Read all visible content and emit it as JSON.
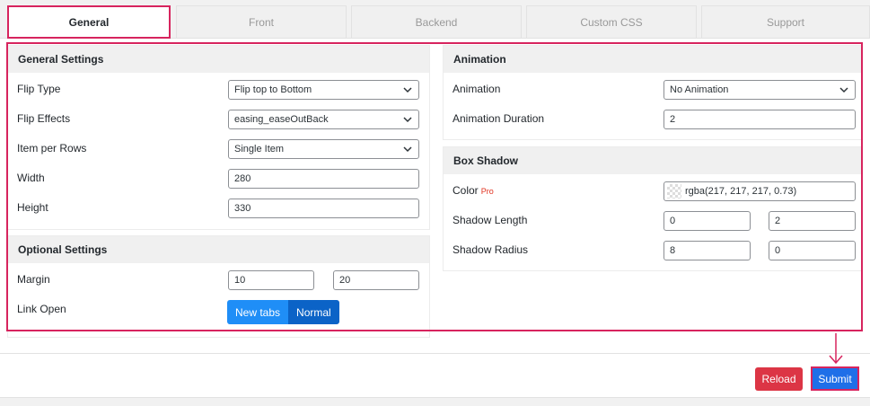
{
  "tabs": [
    {
      "label": "General",
      "active": true
    },
    {
      "label": "Front",
      "active": false
    },
    {
      "label": "Backend",
      "active": false
    },
    {
      "label": "Custom CSS",
      "active": false
    },
    {
      "label": "Support",
      "active": false
    }
  ],
  "general": {
    "title": "General Settings",
    "flip_type": {
      "label": "Flip Type",
      "value": "Flip top to Bottom"
    },
    "flip_effects": {
      "label": "Flip Effects",
      "value": "easing_easeOutBack"
    },
    "item_per_rows": {
      "label": "Item per Rows",
      "value": "Single Item"
    },
    "width": {
      "label": "Width",
      "value": "280"
    },
    "height": {
      "label": "Height",
      "value": "330"
    }
  },
  "optional": {
    "title": "Optional Settings",
    "margin": {
      "label": "Margin",
      "value1": "10",
      "value2": "20"
    },
    "link_open": {
      "label": "Link Open",
      "option1": "New tabs",
      "option2": "Normal"
    }
  },
  "animation": {
    "title": "Animation",
    "animation": {
      "label": "Animation",
      "value": "No Animation"
    },
    "duration": {
      "label": "Animation Duration",
      "value": "2"
    }
  },
  "box_shadow": {
    "title": "Box Shadow",
    "color": {
      "label": "Color",
      "pro": "Pro",
      "value": "rgba(217, 217, 217, 0.73)"
    },
    "length": {
      "label": "Shadow Length",
      "value1": "0",
      "value2": "2"
    },
    "radius": {
      "label": "Shadow Radius",
      "value1": "8",
      "value2": "0"
    }
  },
  "footer": {
    "reload": "Reload",
    "submit": "Submit"
  },
  "colors": {
    "highlight": "#d7245e",
    "primary": "#1f6fe8",
    "danger": "#dc3545"
  }
}
